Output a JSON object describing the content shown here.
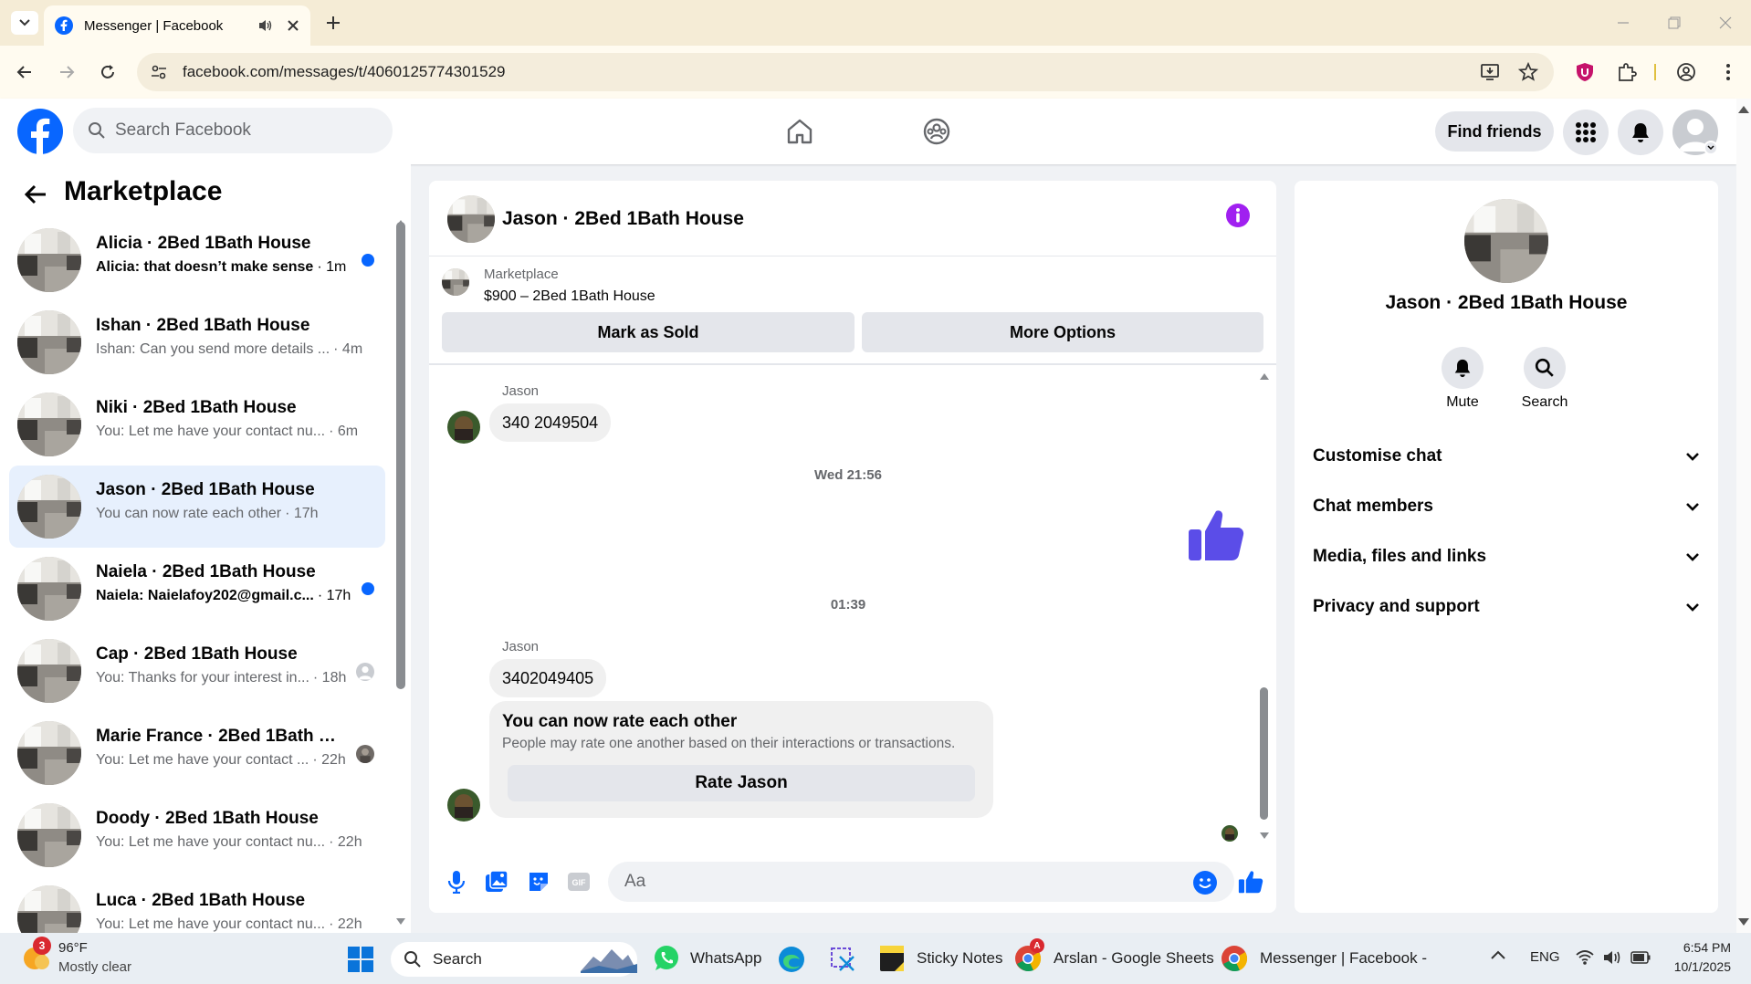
{
  "browser": {
    "tab_title": "Messenger | Facebook",
    "url": "facebook.com/messages/t/4060125774301529"
  },
  "header": {
    "search_placeholder": "Search Facebook",
    "find_friends_label": "Find friends"
  },
  "sidebar": {
    "title": "Marketplace",
    "conversations": [
      {
        "name": "Alicia · 2Bed 1Bath House",
        "preview": "Alicia: that doesn’t make sense",
        "time": "· 1m",
        "unread": true,
        "indicator": "dot"
      },
      {
        "name": "Ishan · 2Bed 1Bath House",
        "preview": "Ishan: Can you send more details ...",
        "time": "· 4m",
        "unread": false,
        "indicator": "none"
      },
      {
        "name": "Niki · 2Bed 1Bath House",
        "preview": "You: Let me have your contact nu...",
        "time": "· 6m",
        "unread": false,
        "indicator": "none"
      },
      {
        "name": "Jason · 2Bed 1Bath House",
        "preview": "You can now rate each other",
        "time": "· 17h",
        "unread": false,
        "indicator": "none",
        "active": true
      },
      {
        "name": "Naiela · 2Bed 1Bath House",
        "preview": "Naiela: Naielafoy202@gmail.c...",
        "time": "· 17h",
        "unread": true,
        "indicator": "dot"
      },
      {
        "name": "Cap · 2Bed 1Bath House",
        "preview": "You: Thanks for your interest in...",
        "time": "· 18h",
        "unread": false,
        "indicator": "seen-default"
      },
      {
        "name": "Marie France · 2Bed 1Bath Ho...",
        "preview": "You: Let me have your contact ...",
        "time": "· 22h",
        "unread": false,
        "indicator": "seen-photo"
      },
      {
        "name": "Doody · 2Bed 1Bath House",
        "preview": "You: Let me have your contact nu...",
        "time": "· 22h",
        "unread": false,
        "indicator": "none"
      },
      {
        "name": "Luca · 2Bed 1Bath House",
        "preview": "You: Let me have your contact nu...",
        "time": "· 22h",
        "unread": false,
        "indicator": "none"
      }
    ]
  },
  "chat": {
    "title": "Jason · 2Bed 1Bath House",
    "listing": {
      "source": "Marketplace",
      "price_title": "$900 – 2Bed 1Bath House"
    },
    "mark_sold_label": "Mark as Sold",
    "more_options_label": "More Options",
    "messages": [
      {
        "sender": "Jason",
        "text": "340 2049504"
      },
      {
        "timestamp": "Wed 21:56"
      },
      {
        "timestamp": "01:39"
      },
      {
        "sender": "Jason",
        "text": "3402049405"
      }
    ],
    "rate_card": {
      "title": "You can now rate each other",
      "subtitle": "People may rate one another based on their interactions or transactions.",
      "button": "Rate Jason"
    },
    "compose_placeholder": "Aa"
  },
  "details": {
    "name": "Jason · 2Bed 1Bath House",
    "mute_label": "Mute",
    "search_label": "Search",
    "sections": [
      "Customise chat",
      "Chat members",
      "Media, files and links",
      "Privacy and support"
    ]
  },
  "taskbar": {
    "weather_temp": "96°F",
    "weather_desc": "Mostly clear",
    "weather_badge": "3",
    "search_label": "Search",
    "apps": [
      {
        "label": "WhatsApp"
      },
      {
        "label": "Sticky Notes"
      },
      {
        "label": "Arslan - Google Sheets"
      },
      {
        "label": "Messenger | Facebook -"
      }
    ],
    "language": "ENG",
    "time": "6:54 PM",
    "date": "10/1/2025"
  },
  "colors": {
    "brand": "#0866ff",
    "like": "#5b4de8",
    "info": "#a020f0"
  }
}
